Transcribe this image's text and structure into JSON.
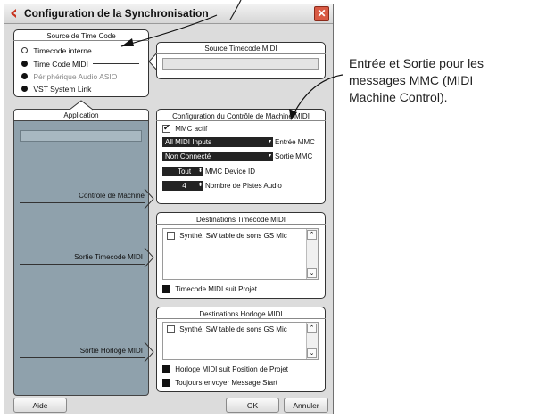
{
  "window": {
    "title": "Configuration de la Synchronisation"
  },
  "source_tc": {
    "title": "Source de Time Code",
    "options": [
      {
        "label": "Timecode interne",
        "state": "unselected"
      },
      {
        "label": "Time Code MIDI",
        "state": "selected"
      },
      {
        "label": "Périphérique Audio ASIO",
        "state": "disabled"
      },
      {
        "label": "VST System Link",
        "state": "selected"
      }
    ]
  },
  "source_midi": {
    "title": "Source Timecode MIDI"
  },
  "application": {
    "title": "Application"
  },
  "mmc": {
    "title": "Configuration du Contrôle de Machine MIDI",
    "active_label": "MMC actif",
    "input_value": "All MIDI Inputs",
    "input_label": "Entrée MMC",
    "output_value": "Non Connecté",
    "output_label": "Sortie MMC",
    "device_value": "Tout",
    "device_label": "MMC Device ID",
    "tracks_value": "4",
    "tracks_label": "Nombre de Pistes Audio"
  },
  "left_labels": {
    "machine": "Contrôle de Machine",
    "tc_out": "Sortie Timecode MIDI",
    "clock_out": "Sortie Horloge MIDI"
  },
  "dest_tc": {
    "title": "Destinations Timecode MIDI",
    "item": "Synthé. SW table de sons GS Mic",
    "follow_label": "Timecode MIDI suit Projet"
  },
  "dest_clock": {
    "title": "Destinations Horloge MIDI",
    "item": "Synthé. SW table de sons GS Mic",
    "follow_label": "Horloge MIDI suit Position de Projet",
    "start_label": "Toujours envoyer Message Start"
  },
  "buttons": {
    "help": "Aide",
    "ok": "OK",
    "cancel": "Annuler"
  },
  "annotation": {
    "lines": [
      "Entrée et Sortie pour les",
      "messages MMC (MIDI",
      "Machine Control)."
    ]
  },
  "colors": {
    "accent_icon": "#c8321e",
    "panel_bg": "#ffffff",
    "window_bg": "#dcdcdc",
    "left_col": "#8fa1ac"
  }
}
